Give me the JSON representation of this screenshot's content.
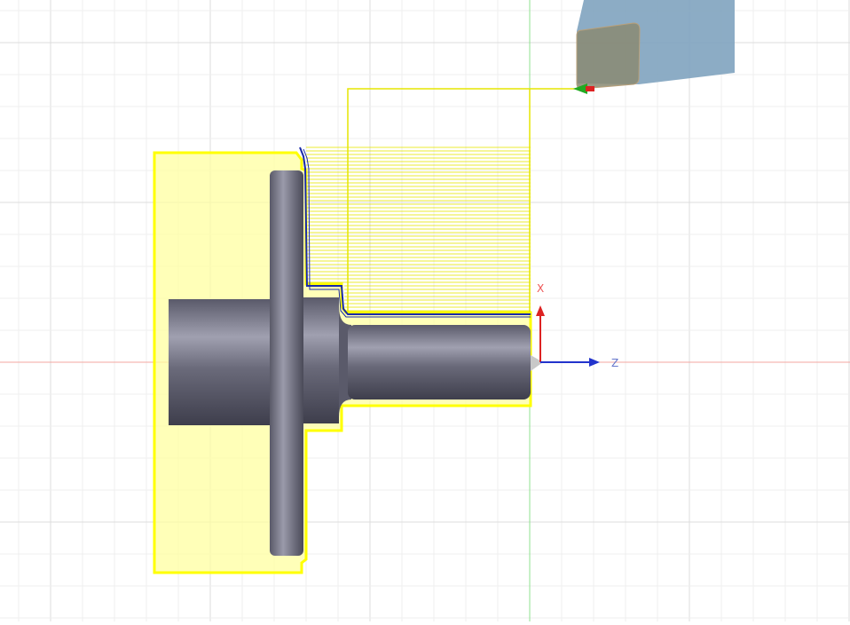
{
  "viewport": {
    "background": "#ffffff",
    "grid_color_major": "#dcdcdc",
    "grid_color_minor": "#efefef",
    "z_axis_line_color": "#f3a7a0",
    "x_axis_line_color": "#8fe08f"
  },
  "stock": {
    "fill": "#ffffa0",
    "outline": "#ffff00"
  },
  "toolpath": {
    "color": "#e6e600",
    "finish_color": "#1a2aa8",
    "lead_color": "#e6e600"
  },
  "part": {
    "color_dark": "#4f4f5e",
    "color_mid": "#6e6e7e",
    "color_light": "#a9a9b8"
  },
  "tool": {
    "holder_color": "#7fa3bf",
    "insert_color": "#8a8a72",
    "tip_color_green": "#22aa22",
    "tip_color_red": "#dd2222"
  },
  "triad": {
    "x_label": "X",
    "z_label": "Z",
    "x_color": "#dd2222",
    "z_color": "#2233cc",
    "label_x_color": "#ee5555",
    "label_z_color": "#6677cc"
  }
}
